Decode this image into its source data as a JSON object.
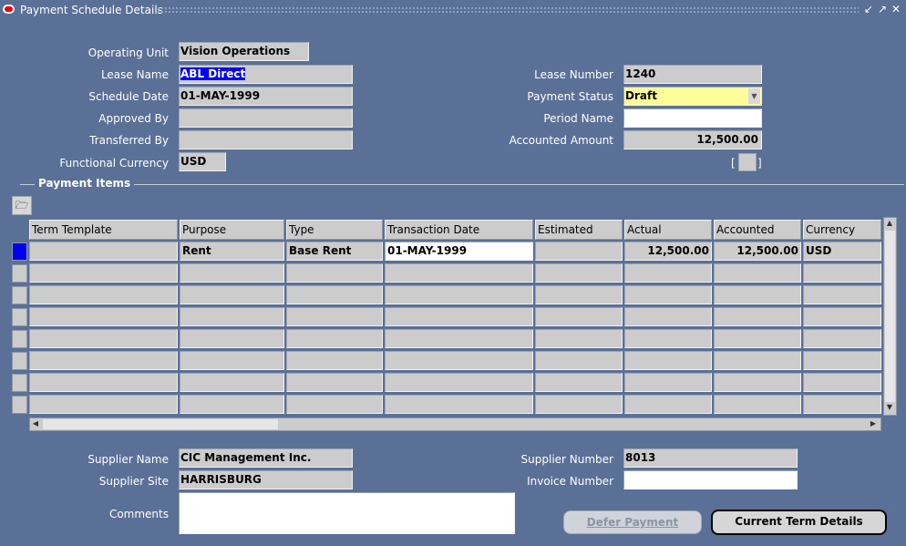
{
  "window": {
    "title": "Payment Schedule Details"
  },
  "header": {
    "operating_unit_label": "Operating Unit",
    "operating_unit": "Vision Operations",
    "lease_name_label": "Lease Name",
    "lease_name": "ABL Direct",
    "schedule_date_label": "Schedule Date",
    "schedule_date": "01-MAY-1999",
    "approved_by_label": "Approved By",
    "approved_by": "",
    "transferred_by_label": "Transferred By",
    "transferred_by": "",
    "functional_currency_label": "Functional Currency",
    "functional_currency": "USD",
    "lease_number_label": "Lease Number",
    "lease_number": "1240",
    "payment_status_label": "Payment Status",
    "payment_status": "Draft",
    "period_name_label": "Period Name",
    "period_name": "",
    "accounted_amount_label": "Accounted Amount",
    "accounted_amount": "12,500.00"
  },
  "payment_items": {
    "title": "Payment Items",
    "columns": [
      "Term Template",
      "Purpose",
      "Type",
      "Transaction Date",
      "Estimated",
      "Actual",
      "Accounted",
      "Currency"
    ],
    "rows": [
      {
        "term_template": "",
        "purpose": "Rent",
        "type": "Base Rent",
        "transaction_date": "01-MAY-1999",
        "estimated": "",
        "actual": "12,500.00",
        "accounted": "12,500.00",
        "currency": "USD"
      }
    ]
  },
  "footer": {
    "supplier_name_label": "Supplier Name",
    "supplier_name": "CIC Management Inc.",
    "supplier_site_label": "Supplier Site",
    "supplier_site": "HARRISBURG",
    "comments_label": "Comments",
    "comments": "",
    "supplier_number_label": "Supplier Number",
    "supplier_number": "8013",
    "invoice_number_label": "Invoice Number",
    "invoice_number": ""
  },
  "buttons": {
    "defer_payment": "Defer Payment",
    "current_term_details": "Current Term Details"
  },
  "colors": {
    "background": "#5a7096",
    "field": "#cccccc",
    "required_field": "#ffff99",
    "selection": "#0000ff"
  }
}
